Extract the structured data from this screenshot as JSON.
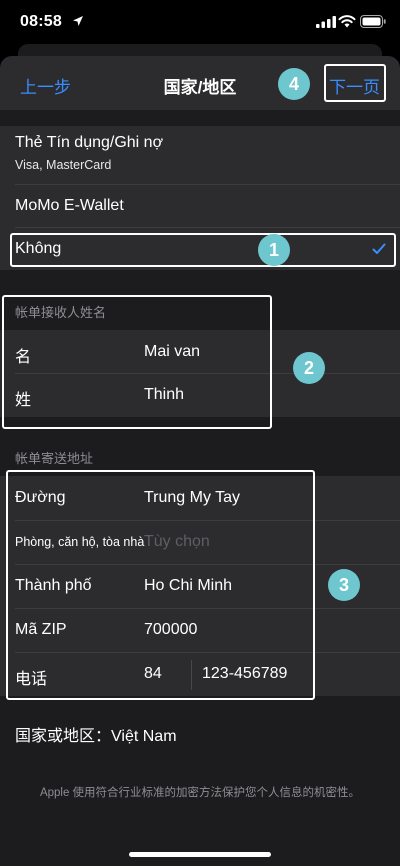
{
  "status": {
    "time": "08:58"
  },
  "nav": {
    "back": "上一步",
    "title": "国家/地区",
    "next": "下一页"
  },
  "payment": {
    "options": [
      {
        "label": "Thẻ Tín dụng/Ghi nợ",
        "sub": "Visa, MasterCard",
        "selected": false
      },
      {
        "label": "MoMo E-Wallet",
        "selected": false
      },
      {
        "label": "Không",
        "selected": true
      }
    ]
  },
  "billing_name": {
    "header": "帐单接收人姓名",
    "first_label": "名",
    "first_value": "Mai van",
    "last_label": "姓",
    "last_value": "Thinh"
  },
  "billing_address": {
    "header": "帐单寄送地址",
    "street_label": "Đường",
    "street_value": "Trung My Tay",
    "room_label": "Phòng, căn hộ, tòa nhà",
    "room_placeholder": "Tùy chọn",
    "city_label": "Thành phố",
    "city_value": "Ho Chi Minh",
    "zip_label": "Mã ZIP",
    "zip_value": "700000",
    "phone_label": "电话",
    "phone_code": "84",
    "phone_number": "123-456789"
  },
  "country": {
    "label": "国家或地区：",
    "value": "Việt Nam"
  },
  "footer": "Apple 使用符合行业标准的加密方法保护您个人信息的机密性。",
  "annotations": [
    "1",
    "2",
    "3",
    "4"
  ],
  "colors": {
    "accent": "#3a8dff",
    "badge": "#6ec6cf",
    "cell": "#2c2c2e",
    "background": "#1c1c1e"
  }
}
